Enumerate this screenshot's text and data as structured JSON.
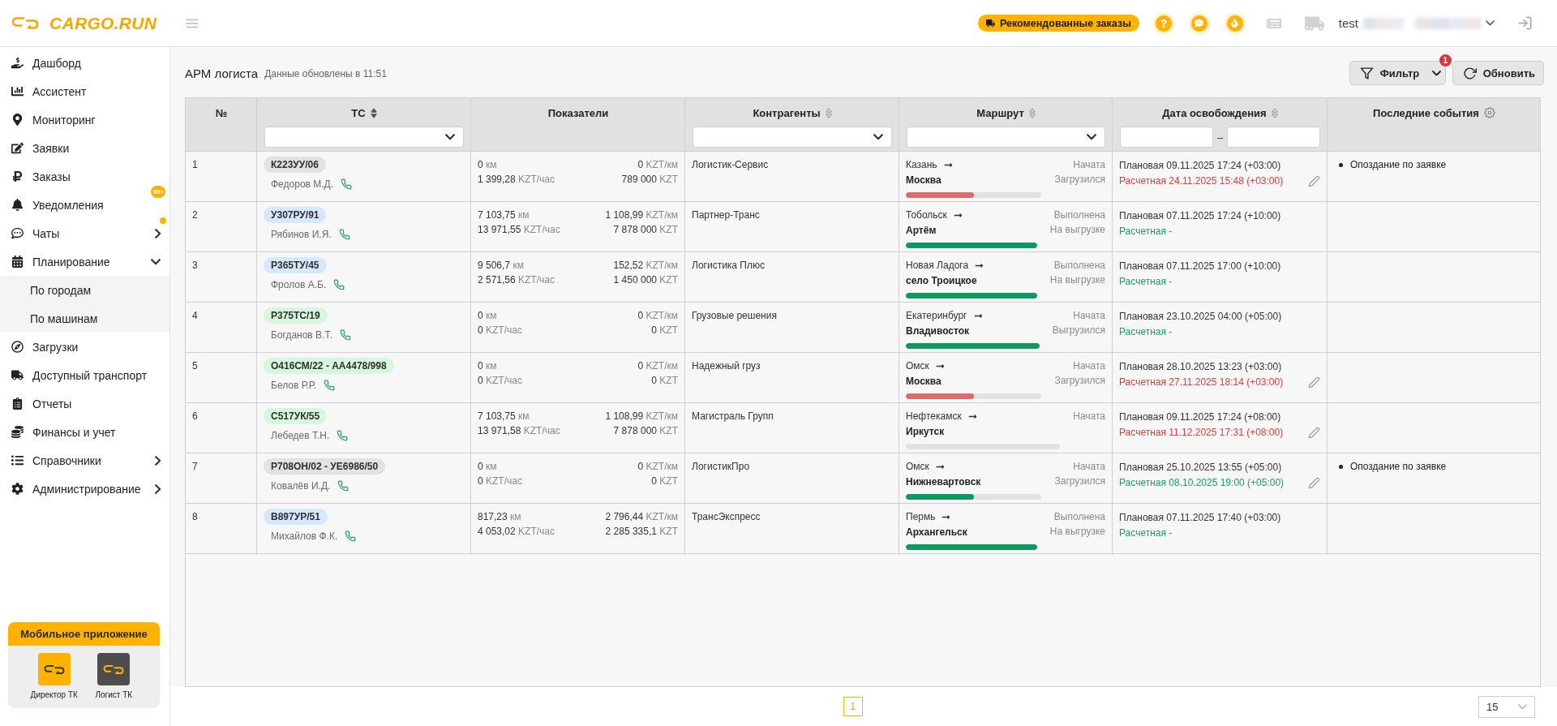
{
  "header": {
    "logo": "CARGO.RUN",
    "recommended_orders": "Рекомендованные заказы",
    "user": "test"
  },
  "sidebar": {
    "items": [
      {
        "label": "Дашборд"
      },
      {
        "label": "Ассистент"
      },
      {
        "label": "Мониторинг"
      },
      {
        "label": "Заявки"
      },
      {
        "label": "Заказы"
      },
      {
        "label": "Уведомления",
        "badge": "99+"
      },
      {
        "label": "Чаты",
        "expanded": false,
        "unread": true
      },
      {
        "label": "Планирование",
        "expanded": true,
        "children": [
          {
            "label": "По городам"
          },
          {
            "label": "По машинам"
          }
        ]
      },
      {
        "label": "Загрузки"
      },
      {
        "label": "Доступный транспорт"
      },
      {
        "label": "Отчеты"
      },
      {
        "label": "Финансы и учет"
      },
      {
        "label": "Справочники",
        "expanded": false
      },
      {
        "label": "Администрирование",
        "expanded": false
      }
    ],
    "mobile_app": {
      "title": "Мобильное приложение",
      "apps": [
        {
          "label": "Директор ТК",
          "kind": "director"
        },
        {
          "label": "Логист ТК",
          "kind": "logist"
        }
      ]
    }
  },
  "page": {
    "title": "АРМ логиста",
    "updated": "Данные обновлены в 11:51",
    "filter_button": {
      "label": "Фильтр",
      "badge": "1"
    },
    "refresh_button": {
      "label": "Обновить"
    }
  },
  "table": {
    "columns": [
      {
        "title": "№"
      },
      {
        "title": "ТС",
        "sorted": true,
        "filter": {
          "kind": "select"
        }
      },
      {
        "title": "Показатели"
      },
      {
        "title": "Контрагенты",
        "sorted": false,
        "filter": {
          "kind": "select"
        }
      },
      {
        "title": "Маршрут",
        "sorted": false,
        "filter": {
          "kind": "select"
        }
      },
      {
        "title": "Дата освобождения",
        "sorted": false,
        "filter": {
          "kind": "range",
          "separator": "–"
        }
      },
      {
        "title": "Последние события",
        "settings": true
      }
    ],
    "rows": [
      {
        "number": "1",
        "vehicle": {
          "plate": "К223УУ/06",
          "color": "#e2e2e2",
          "driver": "Федоров М.Д."
        },
        "metrics": [
          {
            "value": "0",
            "unit": "км"
          },
          {
            "value": "0",
            "unit": "KZT/км"
          },
          {
            "value": "1 399,28",
            "unit": "KZT/час"
          },
          {
            "value": "789 000",
            "unit": "KZT"
          }
        ],
        "contractor": "Логистик-Сервис",
        "route": {
          "from": "Казань",
          "to": "Москва",
          "status": "Начата",
          "substatus": "Загрузился",
          "level": 0.5,
          "color": "#de6b6b"
        },
        "release": {
          "planned": "Плановая 09.11.2025 17:24 (+03:00)",
          "estimated": {
            "text": "Расчетная 24.11.2025 15:48 (+03:00)",
            "color": "#e23b3b"
          },
          "editable": true
        },
        "events": [
          "Опоздание по заявке"
        ]
      },
      {
        "number": "2",
        "vehicle": {
          "plate": "У307РУ/91",
          "color": "#d5e8fc",
          "driver": "Рябинов И.Я."
        },
        "metrics": [
          {
            "value": "7 103,75",
            "unit": "км"
          },
          {
            "value": "1 108,99",
            "unit": "KZT/км"
          },
          {
            "value": "13 971,55",
            "unit": "KZT/час"
          },
          {
            "value": "7 878 000",
            "unit": "KZT"
          }
        ],
        "contractor": "Партнер-Транс",
        "route": {
          "from": "Тобольск",
          "to": "Артём",
          "status": "Выполнена",
          "substatus": "На выгрузке",
          "level": 1,
          "color": "#0e9a5e"
        },
        "release": {
          "planned": "Плановая 07.11.2025 17:24 (+10:00)",
          "estimated": {
            "text": "Расчетная -",
            "color": "#17a163"
          },
          "editable": false
        },
        "events": []
      },
      {
        "number": "3",
        "vehicle": {
          "plate": "Р365ТУ/45",
          "color": "#d5e8fc",
          "driver": "Фролов А.Б."
        },
        "metrics": [
          {
            "value": "9 506,7",
            "unit": "км"
          },
          {
            "value": "152,52",
            "unit": "KZT/км"
          },
          {
            "value": "2 571,56",
            "unit": "KZT/час"
          },
          {
            "value": "1 450 000",
            "unit": "KZT"
          }
        ],
        "contractor": "Логистика Плюс",
        "route": {
          "from": "Новая Ладога",
          "to": "село Троицкое",
          "status": "Выполнена",
          "substatus": "На выгрузке",
          "level": 1,
          "color": "#0e9a5e"
        },
        "release": {
          "planned": "Плановая 07.11.2025 17:00 (+10:00)",
          "estimated": {
            "text": "Расчетная -",
            "color": "#17a163"
          },
          "editable": false
        },
        "events": []
      },
      {
        "number": "4",
        "vehicle": {
          "plate": "Р375ТС/19",
          "color": "#d7f6de",
          "driver": "Богданов В.Т."
        },
        "metrics": [
          {
            "value": "0",
            "unit": "км"
          },
          {
            "value": "0",
            "unit": "KZT/км"
          },
          {
            "value": "0",
            "unit": "KZT/час"
          },
          {
            "value": "0",
            "unit": "KZT"
          }
        ],
        "contractor": "Грузовые решения",
        "route": {
          "from": "Екатеринбург",
          "to": "Владивосток",
          "status": "Начата",
          "substatus": "Выгрузился",
          "level": 1,
          "color": "#0e9a5e"
        },
        "release": {
          "planned": "Плановая 23.10.2025 04:00 (+05:00)",
          "estimated": {
            "text": "Расчетная -",
            "color": "#17a163"
          },
          "editable": false
        },
        "events": []
      },
      {
        "number": "5",
        "vehicle": {
          "plate": "О416СМ/22 - АА4478/998",
          "color": "#d7f6de",
          "driver": "Белов Р.Р."
        },
        "metrics": [
          {
            "value": "0",
            "unit": "км"
          },
          {
            "value": "0",
            "unit": "KZT/км"
          },
          {
            "value": "0",
            "unit": "KZT/час"
          },
          {
            "value": "0",
            "unit": "KZT"
          }
        ],
        "contractor": "Надежный груз",
        "route": {
          "from": "Омск",
          "to": "Москва",
          "status": "Начата",
          "substatus": "Загрузился",
          "level": 0.5,
          "color": "#de6b6b"
        },
        "release": {
          "planned": "Плановая 28.10.2025 13:23 (+03:00)",
          "estimated": {
            "text": "Расчетная 27.11.2025 18:14 (+03:00)",
            "color": "#e23b3b"
          },
          "editable": true
        },
        "events": []
      },
      {
        "number": "6",
        "vehicle": {
          "plate": "С517УК/55",
          "color": "#d7f6de",
          "driver": "Лебедев Т.Н."
        },
        "metrics": [
          {
            "value": "7 103,75",
            "unit": "км"
          },
          {
            "value": "1 108,99",
            "unit": "KZT/км"
          },
          {
            "value": "13 971,58",
            "unit": "KZT/час"
          },
          {
            "value": "7 878 000",
            "unit": "KZT"
          }
        ],
        "contractor": "Магистраль Групп",
        "route": {
          "from": "Нефтекамск",
          "to": "Иркутск",
          "status": "Начата",
          "level": 0
        },
        "release": {
          "planned": "Плановая 09.11.2025 17:24 (+08:00)",
          "estimated": {
            "text": "Расчетная 11.12.2025 17:31 (+08:00)",
            "color": "#e23b3b"
          },
          "editable": true
        },
        "events": []
      },
      {
        "number": "7",
        "vehicle": {
          "plate": "Р708ОН/02 - УЕ6986/50",
          "color": "#e2e2e2",
          "driver": "Ковалёв И.Д."
        },
        "metrics": [
          {
            "value": "0",
            "unit": "км"
          },
          {
            "value": "0",
            "unit": "KZT/км"
          },
          {
            "value": "0",
            "unit": "KZT/час"
          },
          {
            "value": "0",
            "unit": "KZT"
          }
        ],
        "contractor": "ЛогистикПро",
        "route": {
          "from": "Омск",
          "to": "Нижневартовск",
          "status": "Начата",
          "substatus": "Загрузился",
          "level": 0.5,
          "color": "#0e9a5e"
        },
        "release": {
          "planned": "Плановая 25.10.2025 13:55 (+05:00)",
          "estimated": {
            "text": "Расчетная 08.10.2025 19:00 (+05:00)",
            "color": "#17a163"
          },
          "editable": true
        },
        "events": [
          "Опоздание по заявке"
        ]
      },
      {
        "number": "8",
        "vehicle": {
          "plate": "В897УР/51",
          "color": "#d5e8fc",
          "driver": "Михайлов Ф.К."
        },
        "metrics": [
          {
            "value": "817,23",
            "unit": "км"
          },
          {
            "value": "2 796,44",
            "unit": "KZT/км"
          },
          {
            "value": "4 053,02",
            "unit": "KZT/час"
          },
          {
            "value": "2 285 335,1",
            "unit": "KZT"
          }
        ],
        "contractor": "ТрансЭкспресс",
        "route": {
          "from": "Пермь",
          "to": "Архангельск",
          "status": "Выполнена",
          "substatus": "На выгрузке",
          "level": 1,
          "color": "#0e9a5e"
        },
        "release": {
          "planned": "Плановая 07.11.2025 17:40 (+03:00)",
          "estimated": {
            "text": "Расчетная -",
            "color": "#17a163"
          },
          "editable": false
        },
        "events": []
      }
    ]
  },
  "pagination": {
    "pages": [
      {
        "label": "1",
        "selected": true
      }
    ],
    "page_size": "15"
  }
}
